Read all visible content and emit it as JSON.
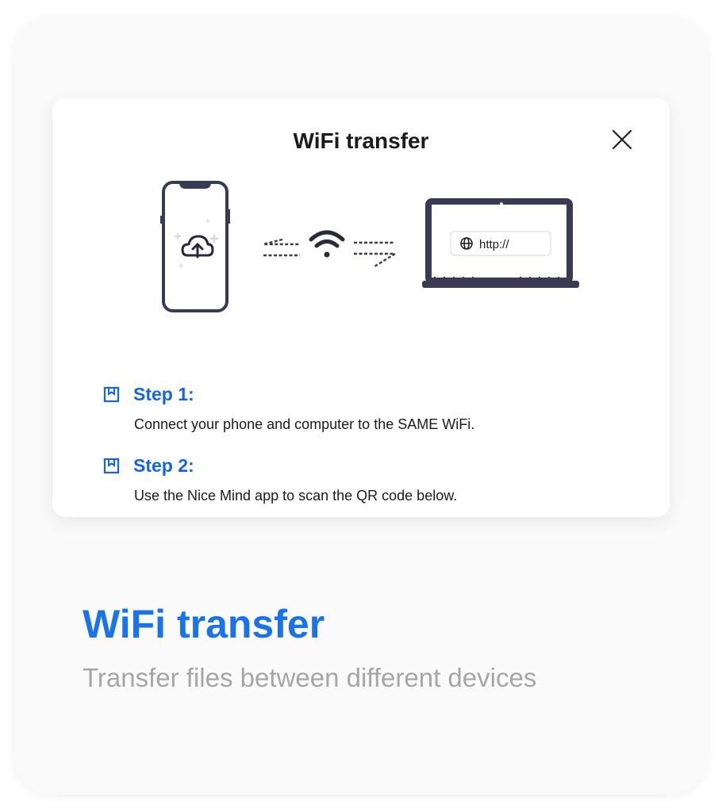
{
  "dialog": {
    "title": "WiFi transfer",
    "url_placeholder": "http://"
  },
  "steps": [
    {
      "label": "Step 1:",
      "text": "Connect your phone and computer to the SAME WiFi."
    },
    {
      "label": "Step 2:",
      "text": "Use the Nice Mind app to scan the QR code below."
    }
  ],
  "feature": {
    "title": "WiFi transfer",
    "subtitle": "Transfer files between different devices"
  },
  "colors": {
    "accent": "#1a73e8",
    "step_blue": "#1464e8",
    "device_outline": "#3a3a55",
    "subtitle_gray": "#a6a6a6"
  },
  "icons": [
    "close-icon",
    "phone-icon",
    "cloud-upload-icon",
    "wifi-icon",
    "laptop-icon",
    "globe-icon",
    "bookmark-icon"
  ]
}
